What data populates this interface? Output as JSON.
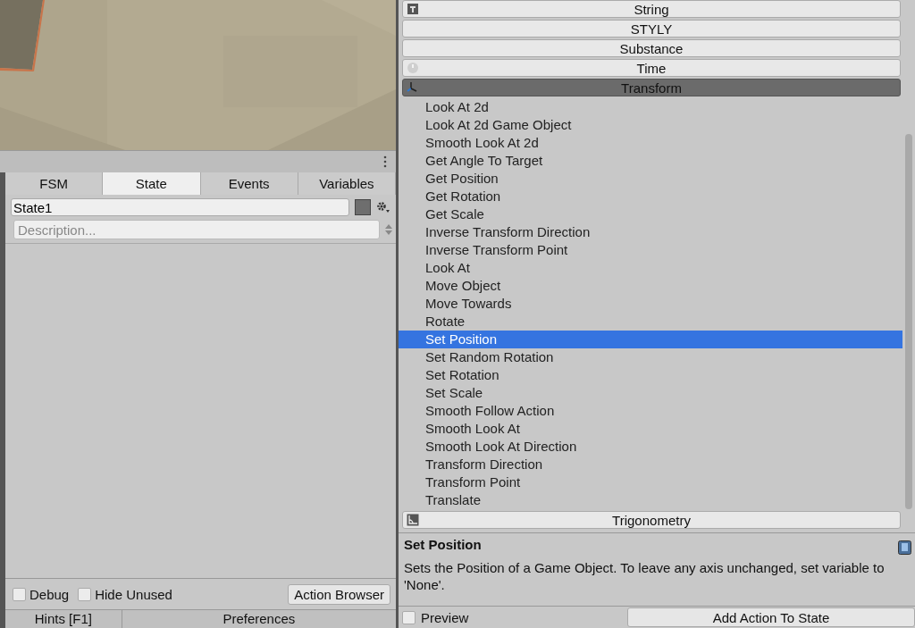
{
  "fsm_panel": {
    "tabs": [
      {
        "label": "FSM",
        "selected": false
      },
      {
        "label": "State",
        "selected": true
      },
      {
        "label": "Events",
        "selected": false
      },
      {
        "label": "Variables",
        "selected": false
      }
    ],
    "state_name": "State1",
    "description": {
      "placeholder": "Description..."
    },
    "options": [
      {
        "label": "Debug",
        "checked": false
      },
      {
        "label": "Hide Unused",
        "checked": false
      }
    ],
    "action_browser_button": "Action Browser",
    "bottom_tabs": [
      "Hints [F1]",
      "Preferences"
    ]
  },
  "action_browser": {
    "categories": [
      {
        "label": "String",
        "kind": "text",
        "expanded": false
      },
      {
        "label": "STYLY",
        "kind": "plain",
        "expanded": false
      },
      {
        "label": "Substance",
        "kind": "plain",
        "expanded": false
      },
      {
        "label": "Time",
        "kind": "clock",
        "expanded": false
      },
      {
        "label": "Transform",
        "kind": "axes",
        "expanded": true,
        "actions": [
          {
            "label": "Look At 2d",
            "selected": false
          },
          {
            "label": "Look At 2d Game Object",
            "selected": false
          },
          {
            "label": "Smooth Look At 2d",
            "selected": false
          },
          {
            "label": "Get Angle To Target",
            "selected": false
          },
          {
            "label": "Get Position",
            "selected": false
          },
          {
            "label": "Get Rotation",
            "selected": false
          },
          {
            "label": "Get Scale",
            "selected": false
          },
          {
            "label": "Inverse Transform Direction",
            "selected": false
          },
          {
            "label": "Inverse Transform Point",
            "selected": false
          },
          {
            "label": "Look At",
            "selected": false
          },
          {
            "label": "Move Object",
            "selected": false
          },
          {
            "label": "Move Towards",
            "selected": false
          },
          {
            "label": "Rotate",
            "selected": false
          },
          {
            "label": "Set Position",
            "selected": true
          },
          {
            "label": "Set Random Rotation",
            "selected": false
          },
          {
            "label": "Set Rotation",
            "selected": false
          },
          {
            "label": "Set Scale",
            "selected": false
          },
          {
            "label": "Smooth Follow Action",
            "selected": false
          },
          {
            "label": "Smooth Look At",
            "selected": false
          },
          {
            "label": "Smooth Look At Direction",
            "selected": false
          },
          {
            "label": "Transform Direction",
            "selected": false
          },
          {
            "label": "Transform Point",
            "selected": false
          },
          {
            "label": "Translate",
            "selected": false
          }
        ]
      },
      {
        "label": "Trigonometry",
        "kind": "angle",
        "expanded": false
      }
    ],
    "help": {
      "title": "Set Position",
      "text": "Sets the Position of a Game Object. To leave any axis unchanged, set variable to 'None'."
    },
    "preview": {
      "label": "Preview",
      "checked": false
    },
    "add_button": "Add Action To State"
  }
}
